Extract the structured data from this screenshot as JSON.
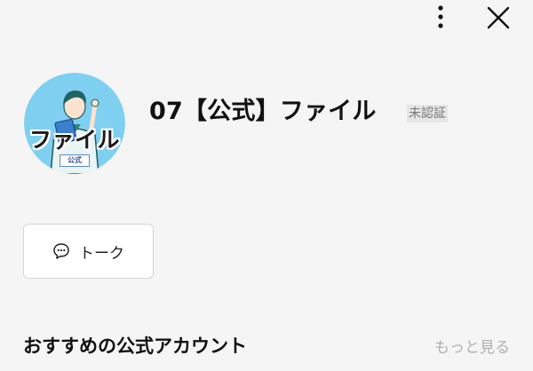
{
  "top_bar": {
    "more_icon": "more-vertical-icon",
    "close_icon": "close-icon"
  },
  "profile": {
    "avatar": {
      "text": "ファイル",
      "badge": "公式",
      "background_color": "#7fcff0"
    },
    "name": "07【公式】ファイル",
    "verification_badge": "未認証"
  },
  "actions": {
    "talk_button": {
      "icon": "chat-bubble-icon",
      "label": "トーク"
    }
  },
  "recommended": {
    "title": "おすすめの公式アカウント",
    "see_more": "もっと見る"
  }
}
